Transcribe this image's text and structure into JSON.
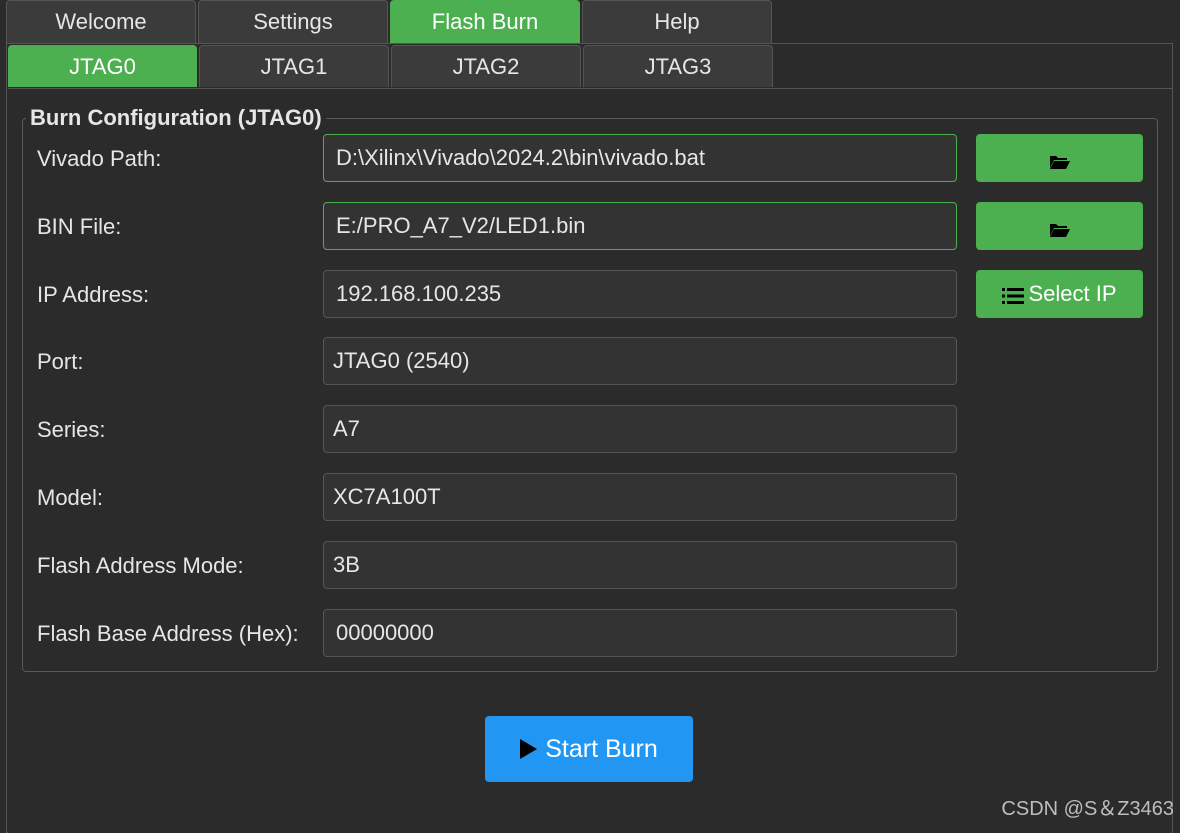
{
  "main_tabs": [
    "Welcome",
    "Settings",
    "Flash Burn",
    "Help"
  ],
  "main_tabs_active": "Flash Burn",
  "jtag_tabs": [
    "JTAG0",
    "JTAG1",
    "JTAG2",
    "JTAG3"
  ],
  "jtag_tabs_active": "JTAG0",
  "group_title": "Burn Configuration (JTAG0)",
  "fields": {
    "vivado_path": {
      "label": "Vivado Path:",
      "value": "D:\\Xilinx\\Vivado\\2024.2\\bin\\vivado.bat"
    },
    "bin_file": {
      "label": "BIN File:",
      "value": "E:/PRO_A7_V2/LED1.bin"
    },
    "ip_address": {
      "label": "IP Address:",
      "value": "192.168.100.235"
    },
    "port": {
      "label": "Port:",
      "value": "JTAG0 (2540)"
    },
    "series": {
      "label": "Series:",
      "value": "A7"
    },
    "model": {
      "label": "Model:",
      "value": "XC7A100T"
    },
    "flash_address_mode": {
      "label": "Flash Address Mode:",
      "value": "3B"
    },
    "flash_base_address": {
      "label": "Flash Base Address (Hex):",
      "value": "00000000"
    }
  },
  "buttons": {
    "browse_vivado_icon": "folder-open-icon",
    "browse_bin_icon": "folder-open-icon",
    "select_ip": "Select IP",
    "select_ip_icon": "list-icon",
    "start_burn": "Start Burn",
    "start_burn_icon": "play-icon"
  },
  "watermark": "CSDN @S＆Z3463",
  "colors": {
    "accent_green": "#4caf50",
    "primary_blue": "#2196f3",
    "background": "#2b2b2b"
  }
}
